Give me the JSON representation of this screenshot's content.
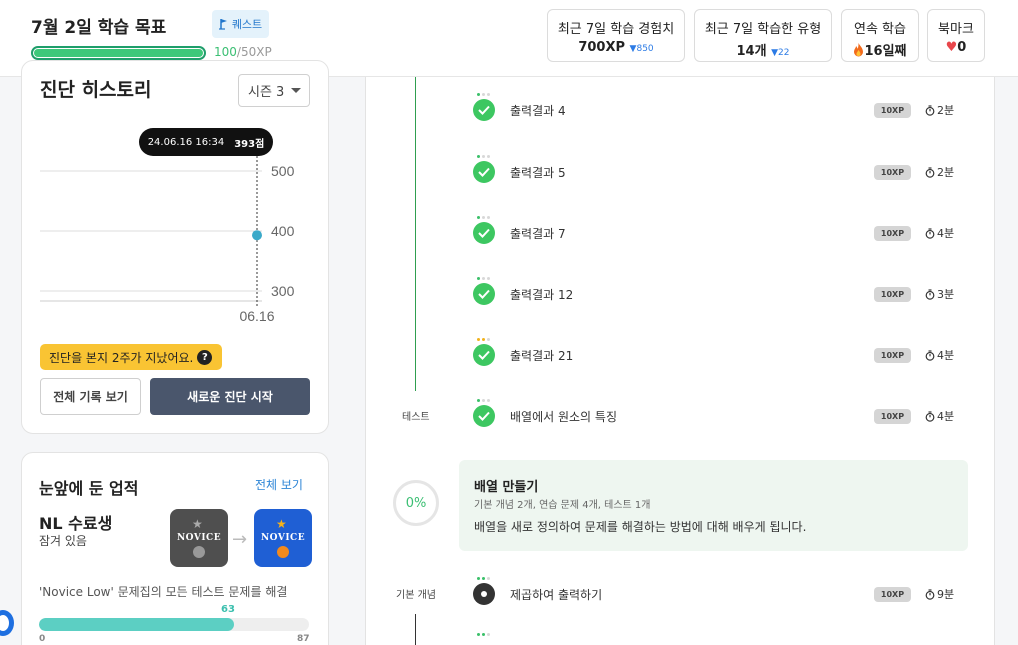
{
  "header": {
    "goal_title": "7월 2일 학습 목표",
    "quest_label": "퀘스트",
    "goal_progress_fraction": 1.0,
    "xp_current": "100",
    "xp_max": "/50XP",
    "stats": [
      {
        "label": "최근 7일 학습 경험치",
        "value": "700XP",
        "delta": "▼850"
      },
      {
        "label": "최근 7일 학습한 유형",
        "value": "14개",
        "delta": "▼22"
      },
      {
        "label": "연속 학습",
        "value": "16일째",
        "icon": "fire-icon"
      },
      {
        "label": "북마크",
        "value": "0",
        "icon": "heart-icon"
      }
    ]
  },
  "history": {
    "title": "진단 히스토리",
    "season": "시즌 3",
    "tooltip_date": "24.06.16 16:34",
    "tooltip_score": "393점",
    "warning": "진단을 본지 2주가 지났어요.",
    "view_all_label": "전체 기록 보기",
    "new_test_label": "새로운 진단 시작"
  },
  "chart_data": {
    "type": "line",
    "x": [
      "06.16"
    ],
    "series": [
      {
        "values": [
          393
        ]
      }
    ],
    "yticks": [
      300,
      400,
      500
    ],
    "ylim": [
      290,
      510
    ],
    "grid": true
  },
  "achievements": {
    "title": "눈앞에 둔 업적",
    "view_all": "전체 보기",
    "name": "NL 수료생",
    "status": "잠겨 있음",
    "badge_text": "NOVICE",
    "description": "'Novice Low' 문제집의 모든 테스트 문제를 해결",
    "progress_value": "63",
    "progress_min": "0",
    "progress_max": "87",
    "progress_fraction": 0.724
  },
  "lessons": [
    {
      "title": "출력결과 4",
      "xp": "10XP",
      "time": "2분",
      "section": "",
      "dots": [
        "g",
        "n",
        "n"
      ]
    },
    {
      "title": "출력결과 5",
      "xp": "10XP",
      "time": "2분",
      "section": "",
      "dots": [
        "g",
        "n",
        "n"
      ]
    },
    {
      "title": "출력결과 7",
      "xp": "10XP",
      "time": "4분",
      "section": "",
      "dots": [
        "g",
        "n",
        "n"
      ]
    },
    {
      "title": "출력결과 12",
      "xp": "10XP",
      "time": "3분",
      "section": "",
      "dots": [
        "g",
        "n",
        "n"
      ]
    },
    {
      "title": "출력결과 21",
      "xp": "10XP",
      "time": "4분",
      "section": "",
      "dots": [
        "y",
        "y",
        "n"
      ]
    },
    {
      "title": "배열에서 원소의 특징",
      "xp": "10XP",
      "time": "4분",
      "section": "테스트",
      "dots": [
        "g",
        "n",
        "n"
      ]
    }
  ],
  "chapter": {
    "percent": "0%",
    "title": "배열 만들기",
    "meta": "기본 개념 2개, 연습 문제 4개, 테스트 1개",
    "description": "배열을 새로 정의하여 문제를 해결하는 방법에 대해 배우게 됩니다."
  },
  "next_lesson": {
    "title": "제곱하여 출력하기",
    "xp": "10XP",
    "time": "9분",
    "section": "기본 개념"
  }
}
